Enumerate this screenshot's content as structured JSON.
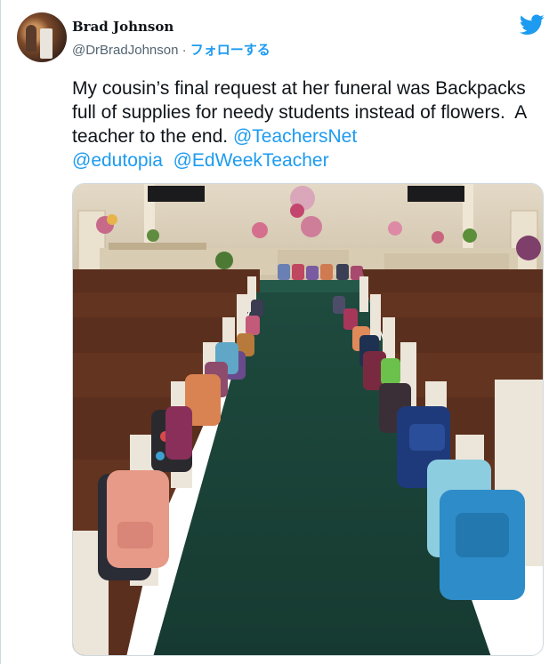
{
  "tweet": {
    "author_name": "Brad Johnson",
    "author_handle": "@DrBradJohnson",
    "separator": " · ",
    "follow_label": "フォローする",
    "text_parts": [
      "My cousin’s final request at her funeral was Backpacks full of supplies for needy students instead of flowers.  A teacher to the end. ",
      "@TeachersNet",
      "\n",
      "@edutopia",
      "  ",
      "@EdWeekTeacher"
    ],
    "icons": {
      "brand": "twitter-bird-icon"
    },
    "colors": {
      "accent": "#1d9bf0",
      "text": "#0f1419",
      "secondary": "#536471",
      "border": "#cfd9de"
    }
  }
}
